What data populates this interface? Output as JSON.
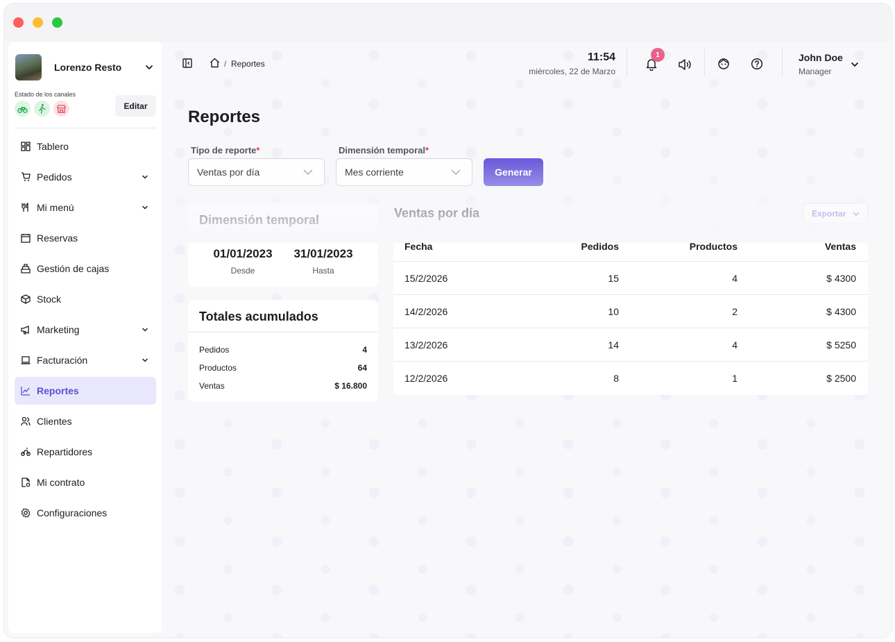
{
  "store": {
    "name": "Lorenzo Resto",
    "channels_label": "Estado de los canales",
    "edit_label": "Editar"
  },
  "nav": {
    "items": [
      {
        "label": "Tablero"
      },
      {
        "label": "Pedidos"
      },
      {
        "label": "Mi menú"
      },
      {
        "label": "Reservas"
      },
      {
        "label": "Gestión de cajas"
      },
      {
        "label": "Stock"
      },
      {
        "label": "Marketing"
      },
      {
        "label": "Facturación"
      },
      {
        "label": "Reportes"
      },
      {
        "label": "Clientes"
      },
      {
        "label": "Repartidores"
      },
      {
        "label": "Mi contrato"
      },
      {
        "label": "Configuraciones"
      }
    ]
  },
  "topbar": {
    "breadcrumb_sep": "/",
    "breadcrumb_page": "Reportes",
    "time": "11:54",
    "date": "miércoles, 22 de Marzo",
    "notifications": "1",
    "user_name": "John Doe",
    "user_role": "Manager"
  },
  "page": {
    "title": "Reportes",
    "report_type_label": "Tipo de reporte",
    "report_type_value": "Ventas por día",
    "time_dim_label": "Dimensión temporal",
    "time_dim_value": "Mes corriente",
    "required_mark": "*",
    "generate_label": "Generar"
  },
  "time_card": {
    "title": "Dimensión temporal",
    "from": "01/01/2023",
    "from_label": "Desde",
    "to": "31/01/2023",
    "to_label": "Hasta"
  },
  "totals": {
    "title": "Totales acumulados",
    "rows": [
      {
        "label": "Pedidos",
        "value": "4"
      },
      {
        "label": "Productos",
        "value": "64"
      },
      {
        "label": "Ventas",
        "value": "$ 16.800"
      }
    ]
  },
  "sales": {
    "title": "Ventas por día",
    "export_label": "Exportar",
    "headers": [
      "Fecha",
      "Pedidos",
      "Productos",
      "Ventas"
    ],
    "rows": [
      [
        "15/2/2026",
        "15",
        "4",
        "$ 4300"
      ],
      [
        "14/2/2026",
        "10",
        "2",
        "$ 4300"
      ],
      [
        "13/2/2026",
        "14",
        "4",
        "$ 5250"
      ],
      [
        "12/2/2026",
        "8",
        "1",
        "$ 2500"
      ]
    ]
  },
  "colors": {
    "accent": "#6b5bdb",
    "active_bg": "#e9e7fb",
    "badge": "#e8628b",
    "channel_green": "#22a04b",
    "channel_red": "#e0455a"
  },
  "icons": [
    "sidebar-toggle-icon",
    "home-icon",
    "bell-icon",
    "speaker-icon",
    "face-icon",
    "help-icon",
    "chevron-down-icon"
  ]
}
